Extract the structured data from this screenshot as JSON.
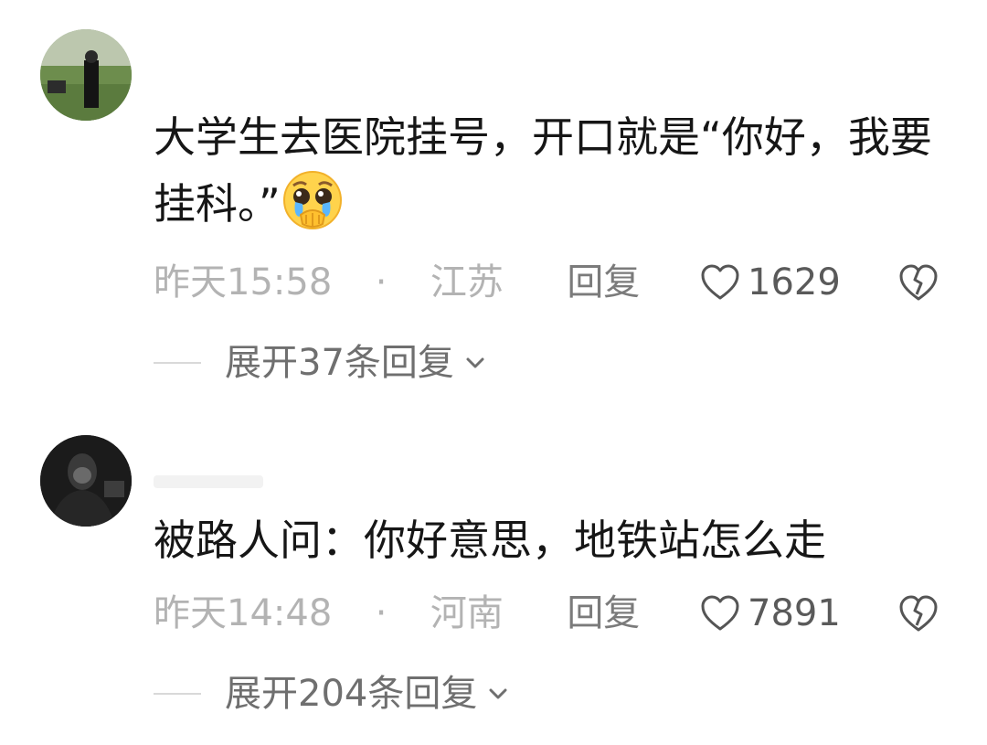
{
  "comments": [
    {
      "text": "大学生去医院挂号，开口就是“你好，我要挂科。”",
      "emoji": "pleading-face-crying-emoji",
      "time": "昨天15:58",
      "dot": "·",
      "location": "江苏",
      "reply_label": "回复",
      "likes": "1629",
      "expand_label": "展开37条回复"
    },
    {
      "text": "被路人问：你好意思，地铁站怎么走",
      "time": "昨天14:48",
      "dot": "·",
      "location": "河南",
      "reply_label": "回复",
      "likes": "7891",
      "expand_label": "展开204条回复"
    }
  ],
  "icons": {
    "like": "heart-outline-icon",
    "dislike": "broken-heart-icon",
    "expand": "chevron-down-icon"
  }
}
